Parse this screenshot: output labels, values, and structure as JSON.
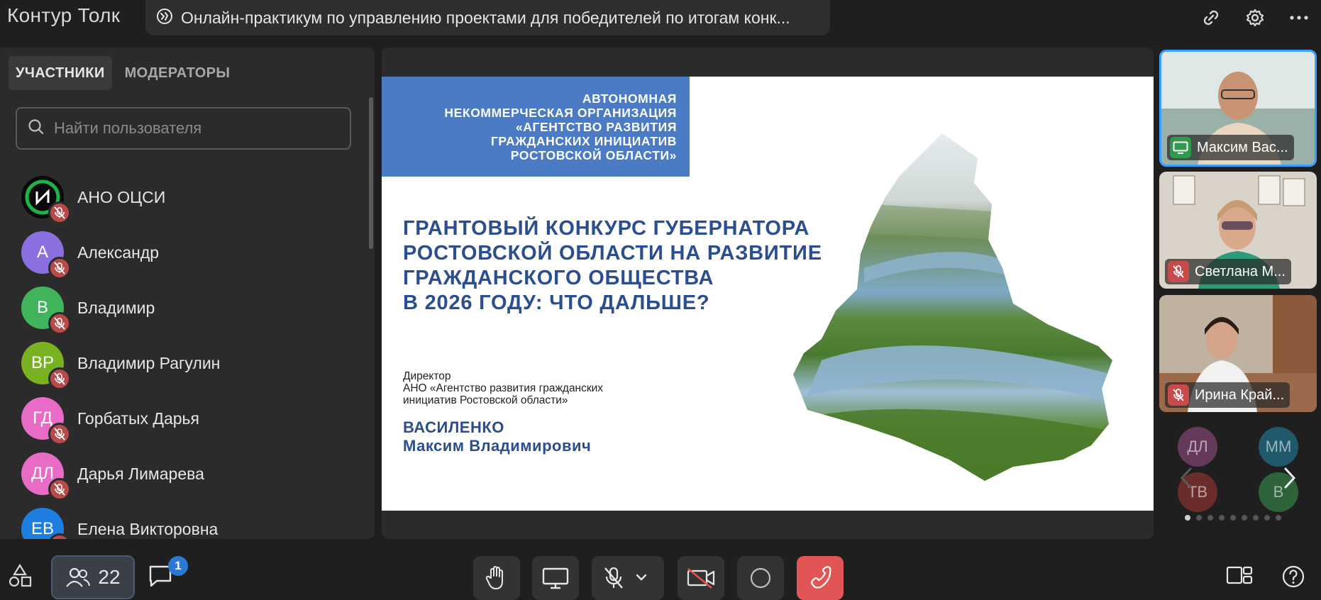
{
  "app": {
    "logo": "Контур Толк"
  },
  "meeting": {
    "title": "Онлайн-практикум по управлению проектами для победителей по итогам конк..."
  },
  "sidebar": {
    "tabs": [
      {
        "label": "УЧАСТНИКИ",
        "active": true
      },
      {
        "label": "МОДЕРАТОРЫ",
        "active": false
      }
    ],
    "search_placeholder": "Найти пользователя",
    "participants": [
      {
        "initials": "",
        "name": "АНО ОЦСИ",
        "color": "#0a0a0a",
        "muted": true,
        "logo": true
      },
      {
        "initials": "А",
        "name": "Александр",
        "color": "#8a6fe0",
        "muted": true
      },
      {
        "initials": "В",
        "name": "Владимир",
        "color": "#3fb45a",
        "muted": true
      },
      {
        "initials": "ВР",
        "name": "Владимир Рагулин",
        "color": "#79b221",
        "muted": true
      },
      {
        "initials": "ГД",
        "name": "Горбатых Дарья",
        "color": "#e86bc6",
        "muted": true
      },
      {
        "initials": "ДЛ",
        "name": "Дарья Лимарева",
        "color": "#e86bc6",
        "muted": true
      },
      {
        "initials": "ЕВ",
        "name": "Елена Викторовна",
        "color": "#1f7fe0",
        "muted": true
      }
    ]
  },
  "slide": {
    "org": "АВТОНОМНАЯ\nНЕКОММЕРЧЕСКАЯ ОРГАНИЗАЦИЯ\n«АГЕНТСТВО РАЗВИТИЯ\nГРАЖДАНСКИХ ИНИЦИАТИВ\nРОСТОВСКОЙ ОБЛАСТИ»",
    "heading": "ГРАНТОВЫЙ КОНКУРС ГУБЕРНАТОРА\nРОСТОВСКОЙ ОБЛАСТИ НА РАЗВИТИЕ\nГРАЖДАНСКОГО ОБЩЕСТВА\nВ 2026 ГОДУ: ЧТО ДАЛЬШЕ?",
    "role": "Директор\nАНО «Агентство развития гражданских\nинициатив Ростовской области»",
    "speaker": "ВАСИЛЕНКО\nМаксим Владимирович"
  },
  "videos": [
    {
      "name": "Максим Вас...",
      "badge": "screen",
      "active": true
    },
    {
      "name": "Светлана М...",
      "badge": "muted",
      "active": false
    },
    {
      "name": "Ирина Край...",
      "badge": "muted",
      "active": false
    }
  ],
  "more_participants": [
    "ДЛ",
    "ММ",
    "ТВ",
    "В"
  ],
  "bottombar": {
    "participants_count": "22",
    "chat_unread": "1"
  }
}
